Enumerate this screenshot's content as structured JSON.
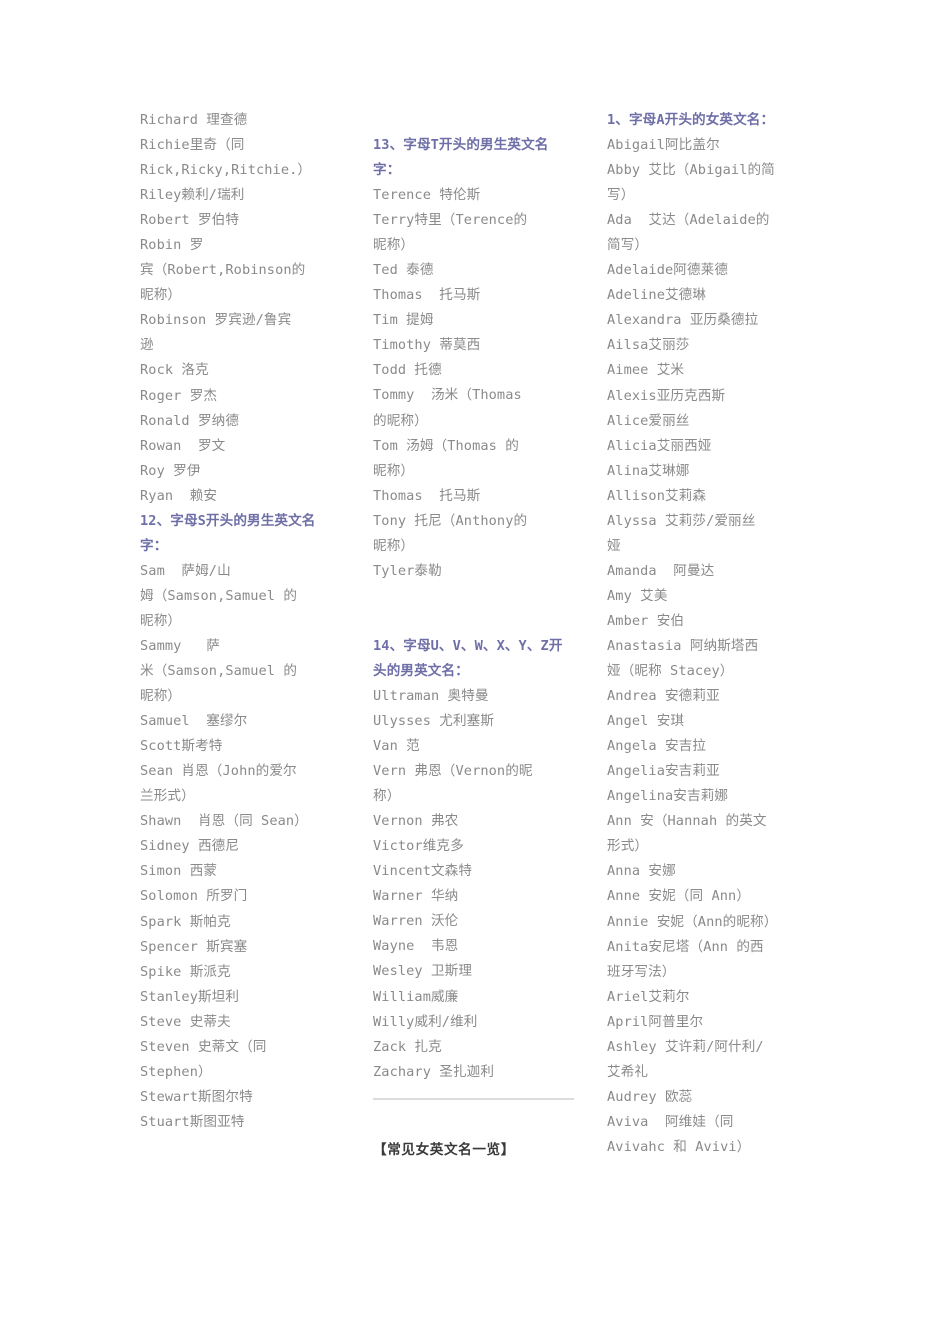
{
  "document": {
    "page_background": "#ffffff",
    "body_text_color": "#8a8a8a",
    "heading_text_color": "#6f6fa8",
    "emphasis_text_color": "#3a3a3a",
    "rule_color": "#dcdcdc"
  },
  "columns": [
    {
      "id": "column-1",
      "blocks": [
        {
          "type": "list",
          "lines": [
            "Richard 理查德",
            "Richie里奇（同",
            "Rick,Ricky,Ritchie.）",
            "Riley赖利/瑞利",
            "Robert 罗伯特",
            "Robin 罗",
            "宾（Robert,Robinson的",
            "昵称）",
            "Robinson 罗宾逊/鲁宾",
            "逊",
            "Rock 洛克",
            "Roger 罗杰",
            "Ronald 罗纳德",
            "Rowan  罗文",
            "Roy 罗伊",
            "Ryan  赖安"
          ]
        },
        {
          "type": "heading",
          "text": "12、字母S开头的男生英文名字："
        },
        {
          "type": "list",
          "lines": [
            "Sam  萨姆/山",
            "姆（Samson,Samuel 的",
            "昵称）",
            "Sammy   萨",
            "米（Samson,Samuel 的",
            "昵称）",
            "Samuel  塞缪尔",
            "Scott斯考特",
            "Sean 肖恩（John的爱尔",
            "兰形式）",
            "Shawn  肖恩（同 Sean）",
            "Sidney 西德尼",
            "Simon 西蒙",
            "Solomon 所罗门",
            "Spark 斯帕克",
            "Spencer 斯宾塞",
            "Spike 斯派克",
            "Stanley斯坦利",
            "Steve 史蒂夫",
            "Steven 史蒂文（同",
            "Stephen）",
            "Stewart斯图尔特",
            "Stuart斯图亚特"
          ]
        }
      ]
    },
    {
      "id": "column-2",
      "blocks": [
        {
          "type": "spacer",
          "size": "small"
        },
        {
          "type": "heading",
          "text": "13、字母T开头的男生英文名字："
        },
        {
          "type": "list",
          "lines": [
            "Terence 特伦斯",
            "Terry特里（Terence的",
            "昵称）",
            "Ted 泰德",
            "Thomas  托马斯",
            "Tim 提姆",
            "Timothy 蒂莫西",
            "Todd 托德",
            "Tommy  汤米（Thomas",
            "的昵称）",
            "Tom 汤姆（Thomas 的",
            "昵称）",
            "Thomas  托马斯",
            "Tony 托尼（Anthony的",
            "昵称）",
            "Tyler泰勒"
          ]
        },
        {
          "type": "spacer",
          "size": "medium"
        },
        {
          "type": "heading",
          "text": "14、字母U、V、W、X、Y、Z开头的男英文名："
        },
        {
          "type": "list",
          "lines": [
            "Ultraman 奥特曼",
            "Ulysses 尤利塞斯",
            "Van 范",
            "Vern 弗恩（Vernon的昵",
            "称）",
            "Vernon 弗农",
            "Victor维克多",
            "Vincent文森特",
            "Warner 华纳",
            "Warren 沃伦",
            "Wayne  韦恩",
            "Wesley 卫斯理",
            "William威廉",
            "Willy威利/维利",
            "Zack 扎克",
            "Zachary 圣扎迦利"
          ]
        },
        {
          "type": "rule"
        },
        {
          "type": "bracket-title",
          "text": "【常见女英文名一览】"
        }
      ]
    },
    {
      "id": "column-3",
      "blocks": [
        {
          "type": "heading",
          "text": "1、字母A开头的女英文名："
        },
        {
          "type": "list",
          "lines": [
            "Abigail阿比盖尔",
            "Abby 艾比（Abigail的简",
            "写）",
            "Ada  艾达（Adelaide的",
            "简写）",
            "Adelaide阿德莱德",
            "Adeline艾德琳",
            "Alexandra 亚历桑德拉",
            "Ailsa艾丽莎",
            "Aimee 艾米",
            "Alexis亚历克西斯",
            "Alice爱丽丝",
            "Alicia艾丽西娅",
            "Alina艾琳娜",
            "Allison艾莉森",
            "Alyssa 艾莉莎/爱丽丝",
            "娅",
            "Amanda  阿曼达",
            "Amy 艾美",
            "Amber 安伯",
            "Anastasia 阿纳斯塔西",
            "娅（昵称 Stacey）",
            "Andrea 安德莉亚",
            "Angel 安琪",
            "Angela 安吉拉",
            "Angelia安吉莉亚",
            "Angelina安吉莉娜",
            "Ann 安（Hannah 的英文",
            "形式）",
            "Anna 安娜",
            "Anne 安妮（同 Ann）",
            "Annie 安妮（Ann的昵称）",
            "Anita安尼塔（Ann 的西",
            "班牙写法）",
            "Ariel艾莉尔",
            "April阿普里尔",
            "Ashley 艾许莉/阿什利/",
            "艾希礼",
            "Audrey 欧蕊",
            "Aviva  阿维娃（同",
            "Avivahc 和 Avivi）"
          ]
        }
      ]
    }
  ]
}
